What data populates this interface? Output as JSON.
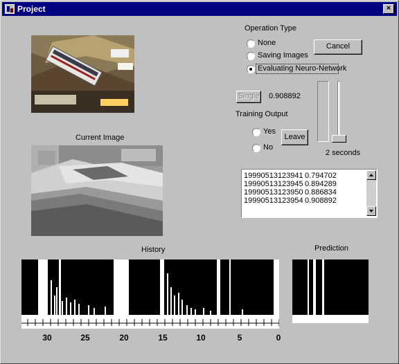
{
  "window": {
    "title": "Project",
    "close_label": "×"
  },
  "operation": {
    "heading": "Operation Type",
    "options": [
      "None",
      "Saving Images",
      "Evaluating Neuro-Network"
    ],
    "selected_index": 2,
    "cancel_label": "Cancel"
  },
  "evaluation": {
    "single_label": "Single",
    "value": "0.908892"
  },
  "training": {
    "heading": "Training Output",
    "yes_label": "Yes",
    "no_label": "No",
    "leave_label": "Leave"
  },
  "slider": {
    "caption": "2 seconds"
  },
  "current_image": {
    "label": "Current Image"
  },
  "log": [
    {
      "id": "19990513123941",
      "value": "0.794702"
    },
    {
      "id": "19990513123945",
      "value": "0.894289"
    },
    {
      "id": "19990513123950",
      "value": "0.886834"
    },
    {
      "id": "19990513123954",
      "value": "0.908892"
    }
  ],
  "history": {
    "title": "History",
    "ticks": [
      "30",
      "25",
      "20",
      "15",
      "10",
      "5",
      "0"
    ]
  },
  "prediction": {
    "title": "Prediction"
  },
  "colors": {
    "title_bar": "#000080",
    "face": "#c0c0c0",
    "plot_fill": "#000000"
  }
}
